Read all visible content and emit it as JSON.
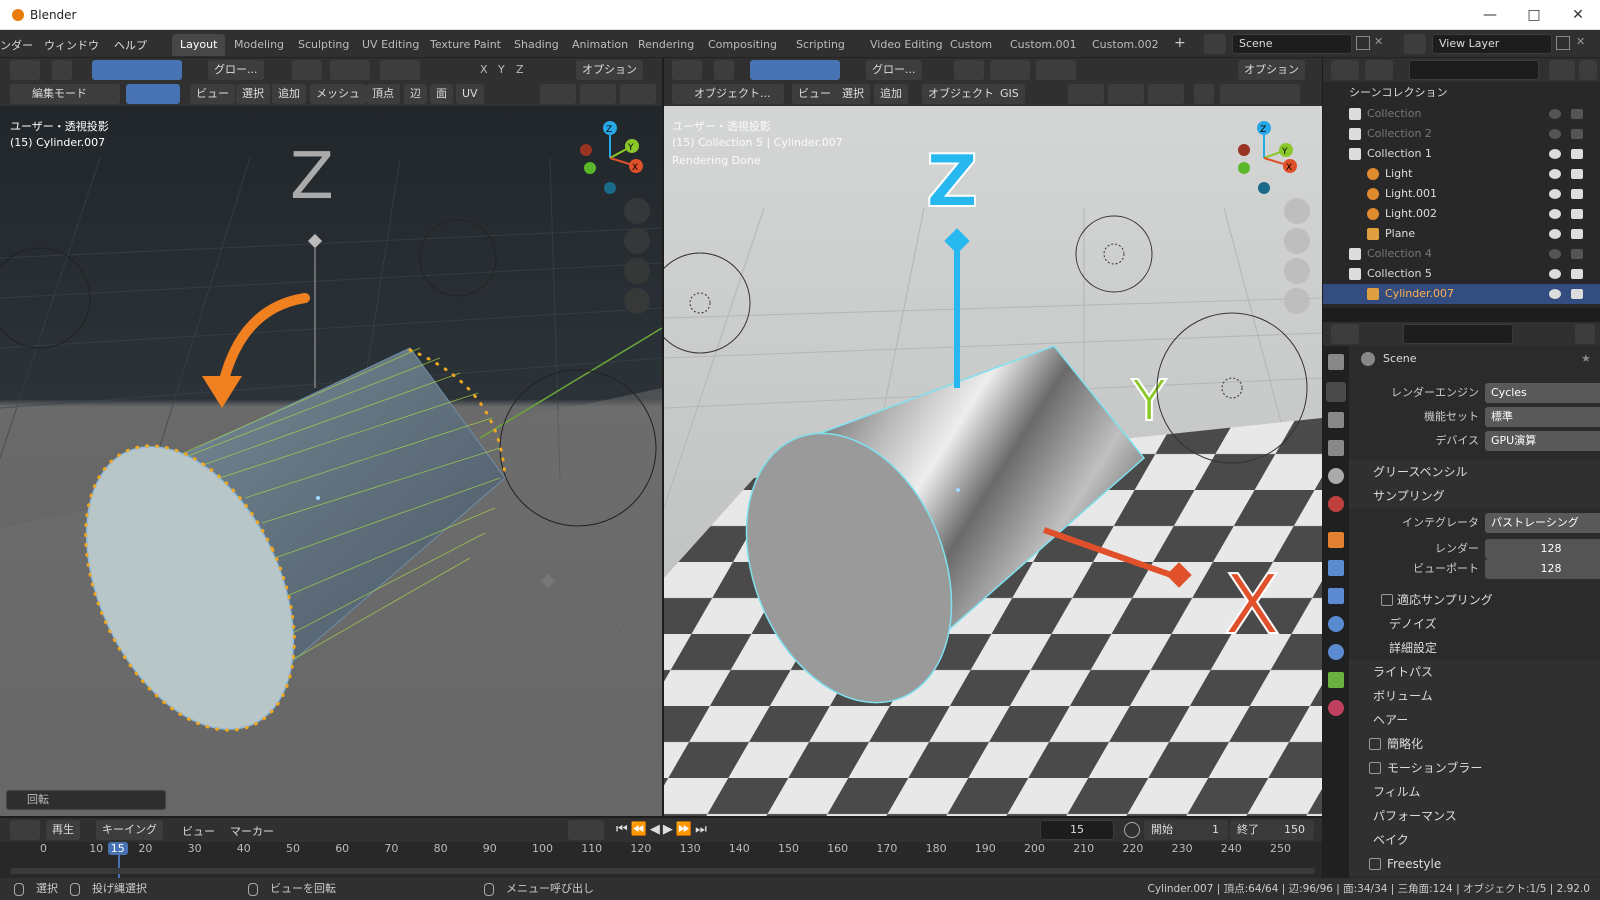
{
  "window": {
    "title": "Blender"
  },
  "menus": [
    "ンダー",
    "ウィンドウ",
    "ヘルプ"
  ],
  "workspaces": [
    "Layout",
    "Modeling",
    "Sculpting",
    "UV Editing",
    "Texture Paint",
    "Shading",
    "Animation",
    "Rendering",
    "Compositing",
    "Scripting",
    "Video Editing",
    "Custom",
    "Custom.001",
    "Custom.002"
  ],
  "scene": {
    "name": "Scene",
    "view_layer": "View Layer"
  },
  "left_viewport": {
    "header": {
      "orientation": "グロー...",
      "options": "オプション",
      "axes": [
        "X",
        "Y",
        "Z"
      ]
    },
    "header2": {
      "mode": "編集モード",
      "menus": [
        "ビュー",
        "選択",
        "追加",
        "メッシュ",
        "頂点",
        "辺",
        "面",
        "UV"
      ]
    },
    "info_line1": "ユーザー・透視投影",
    "info_line2": "(15) Cylinder.007",
    "operator_panel": "回転",
    "axis_z": "Z"
  },
  "right_viewport": {
    "header": {
      "orientation": "グロー...",
      "options": "オプション"
    },
    "header2": {
      "mode": "オブジェクト...",
      "menus": [
        "ビュー",
        "選択",
        "追加",
        "オブジェクト",
        "GIS"
      ]
    },
    "info_line1": "ユーザー・透視投影",
    "info_line2": "(15) Collection 5 | Cylinder.007",
    "info_line3": "Rendering Done",
    "axis_z": "Z",
    "axis_y": "Y",
    "axis_x": "X"
  },
  "outliner": {
    "root": "シーンコレクション",
    "rows": [
      {
        "label": "Collection",
        "indent": 0,
        "dim": true
      },
      {
        "label": "Collection 2",
        "indent": 0,
        "dim": true
      },
      {
        "label": "Collection 1",
        "indent": 0,
        "dim": false
      },
      {
        "label": "Light",
        "indent": 1,
        "dim": false
      },
      {
        "label": "Light.001",
        "indent": 1,
        "dim": false
      },
      {
        "label": "Light.002",
        "indent": 1,
        "dim": false
      },
      {
        "label": "Plane",
        "indent": 1,
        "dim": false
      },
      {
        "label": "Collection 4",
        "indent": 0,
        "dim": true
      },
      {
        "label": "Collection 5",
        "indent": 0,
        "dim": false
      },
      {
        "label": "Cylinder.007",
        "indent": 1,
        "dim": false,
        "selected": true
      }
    ]
  },
  "properties": {
    "context": "Scene",
    "render_engine_label": "レンダーエンジン",
    "render_engine": "Cycles",
    "feature_set_label": "機能セット",
    "feature_set": "標準",
    "device_label": "デバイス",
    "device": "GPU演算",
    "grease_pencil": "グリースペンシル",
    "sampling": "サンプリング",
    "integrator_label": "インテグレータ",
    "integrator": "パストレーシング",
    "render_label": "レンダー",
    "render_samples": "128",
    "viewport_label": "ビューポート",
    "viewport_samples": "128",
    "adaptive": "適応サンプリング",
    "denoise": "デノイズ",
    "advanced": "詳細設定",
    "light_paths": "ライトパス",
    "volume": "ボリューム",
    "hair": "ヘアー",
    "simplify": "簡略化",
    "motion_blur": "モーションブラー",
    "film": "フィルム",
    "performance": "パフォーマンス",
    "bake": "ベイク",
    "freestyle": "Freestyle"
  },
  "timeline": {
    "play": "再生",
    "keying": "キーイング",
    "view": "ビュー",
    "marker": "マーカー",
    "current_frame": "15",
    "start_label": "開始",
    "start": "1",
    "end_label": "終了",
    "end": "150",
    "ticks": [
      "0",
      "10",
      "15",
      "20",
      "30",
      "40",
      "50",
      "60",
      "70",
      "80",
      "90",
      "100",
      "110",
      "120",
      "130",
      "140",
      "150",
      "160",
      "170",
      "180",
      "190",
      "200",
      "210",
      "220",
      "230",
      "240",
      "250"
    ]
  },
  "status": {
    "select": "選択",
    "box_select": "投げ縄選択",
    "rotate_view": "ビューを回転",
    "call_menu": "メニュー呼び出し",
    "stats": "Cylinder.007 | 頂点:64/64 | 辺:96/96 | 面:34/34 | 三角面:124 | オブジェクト:1/5 | 2.92.0"
  },
  "colors": {
    "accent": "#4772b3",
    "selected_outline": "#4cc9e8",
    "orange": "#f08020",
    "axis_x": "#e0502a",
    "axis_y": "#8ac82a",
    "axis_z": "#28a8e8"
  }
}
